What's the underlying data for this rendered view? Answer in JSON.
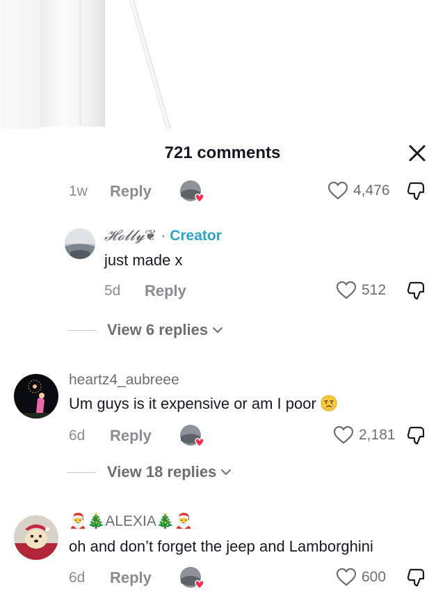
{
  "header": {
    "title": "721 comments"
  },
  "colors": {
    "accent": "#fe2c55",
    "creator": "#2ba4c8",
    "muted": "#8a8b91",
    "text": "#161823"
  },
  "comments": [
    {
      "time": "1w",
      "reply_label": "Reply",
      "likes": "4,476",
      "icons": [
        "creator-liked-avatar-icon",
        "heart-outline-icon",
        "dislike-thumb-icon"
      ]
    },
    {
      "username": "𝓗𝓸𝓵𝓵𝔂",
      "username_suffix": "❦",
      "separator": "·",
      "creator_label": "Creator",
      "text": "just made x",
      "time": "5d",
      "reply_label": "Reply",
      "likes": "512",
      "view_replies": "View 6 replies"
    },
    {
      "username": "heartz4_aubreee",
      "text": "Um guys is it expensive or am I poor",
      "text_emoji": "crying-face-emoji",
      "time": "6d",
      "reply_label": "Reply",
      "likes": "2,181",
      "view_replies": "View 18 replies"
    },
    {
      "username": "🎅🎄ALEXIA🎄🎅",
      "text": "oh and don’t forget the jeep and Lamborghini",
      "time": "6d",
      "reply_label": "Reply",
      "likes": "600"
    }
  ]
}
